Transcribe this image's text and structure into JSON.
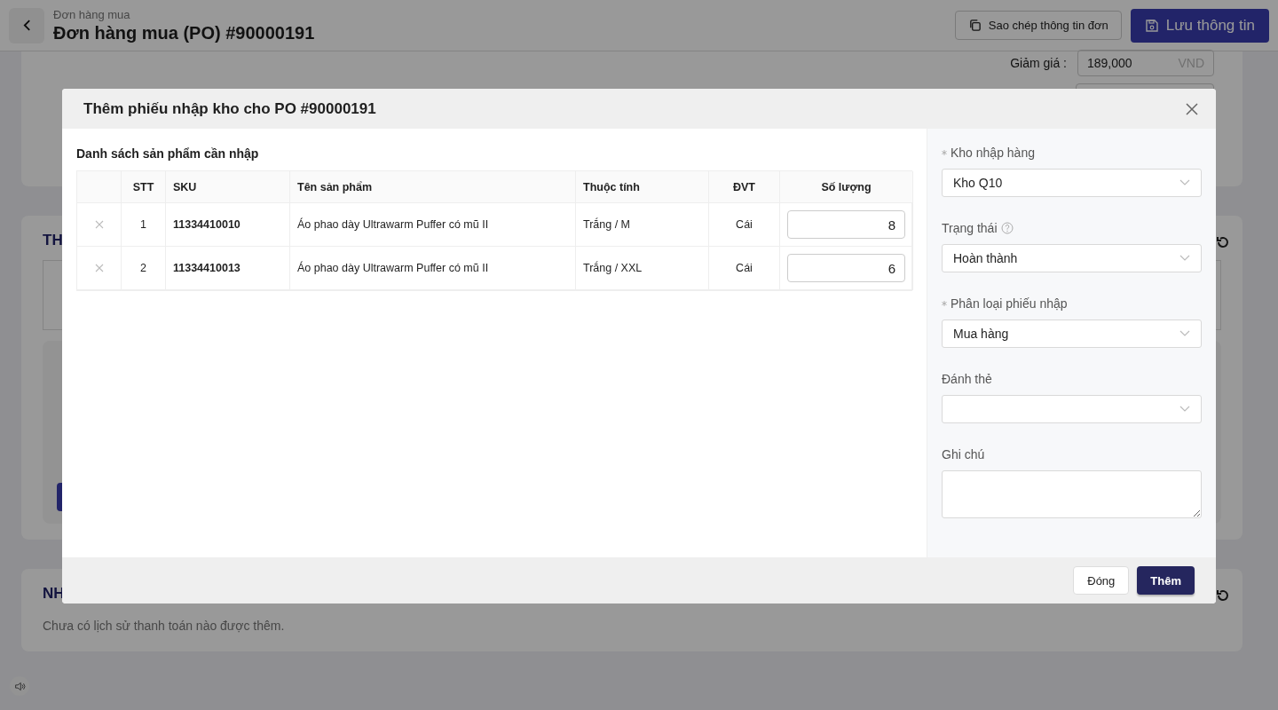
{
  "header": {
    "breadcrumb": "Đơn hàng mua",
    "title": "Đơn hàng mua (PO) #90000191",
    "buttons": [
      {
        "label": "Sao chép thông tin đơn",
        "kind": "secondary"
      },
      {
        "label": "Lưu thông tin",
        "kind": "primary"
      }
    ]
  },
  "summary_card": {
    "discount_label": "Giảm giá :",
    "discount_value": "189,000",
    "discount_unit": "VND"
  },
  "items_card": {
    "title": "TH"
  },
  "payments_card": {
    "title": "NH",
    "empty_text": "Chưa có lịch sử thanh toán nào được thêm."
  },
  "modal": {
    "title": "Thêm phiếu nhập kho cho PO #90000191",
    "section_title": "Danh sách sản phẩm cần nhập",
    "table": {
      "columns": [
        "STT",
        "SKU",
        "Tên sản phẩm",
        "Thuộc tính",
        "ĐVT",
        "Số lượng"
      ],
      "rows": [
        {
          "stt": "1",
          "sku": "11334410010",
          "name": "Áo phao dày Ultrawarm Puffer có mũ II",
          "attribute": "Trắng / M",
          "unit": "Cái",
          "quantity": "8"
        },
        {
          "stt": "2",
          "sku": "11334410013",
          "name": "Áo phao dày Ultrawarm Puffer có mũ II",
          "attribute": "Trắng / XXL",
          "unit": "Cái",
          "quantity": "6"
        }
      ]
    },
    "fields": [
      {
        "kind": "select",
        "label": "Kho nhập hàng",
        "required": true,
        "help": false,
        "value": "Kho Q10"
      },
      {
        "kind": "select",
        "label": "Trạng thái",
        "required": false,
        "help": true,
        "value": "Hoàn thành"
      },
      {
        "kind": "select",
        "label": "Phân loại phiếu nhập",
        "required": true,
        "help": false,
        "value": "Mua hàng"
      },
      {
        "kind": "select",
        "label": "Đánh thẻ",
        "required": false,
        "help": false
      },
      {
        "kind": "textarea",
        "label": "Ghi chú",
        "required": false,
        "help": false
      }
    ],
    "buttons": [
      {
        "label": "Đóng",
        "kind": "secondary"
      },
      {
        "label": "Thêm",
        "kind": "primary"
      }
    ]
  }
}
